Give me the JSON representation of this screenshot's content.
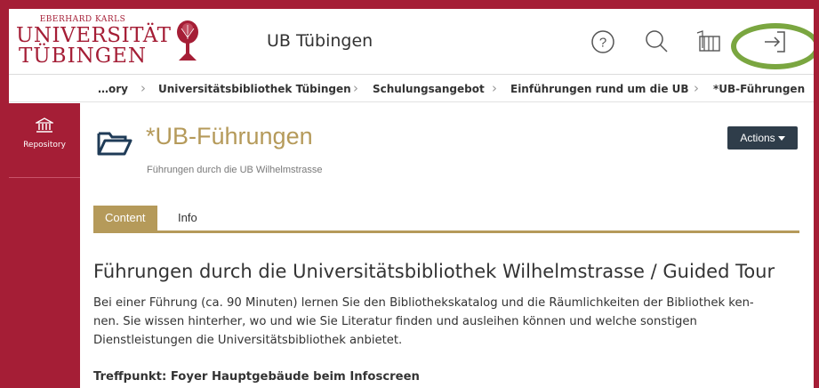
{
  "header": {
    "logo": {
      "line1": "EBERHARD KARLS",
      "line2": "UNIVERSITÄT",
      "line3": "TÜBINGEN"
    },
    "title": "UB Tübingen",
    "icons": [
      "help-icon",
      "search-icon",
      "library-icon",
      "login-icon"
    ]
  },
  "breadcrumb": {
    "items": [
      "…ory",
      "Universitätsbibliothek Tübingen",
      "Schulungsangebot",
      "Einführungen rund um die UB",
      "*UB-Führungen"
    ]
  },
  "sidebar": {
    "items": [
      {
        "label": "Repository",
        "icon": "institution-icon"
      }
    ]
  },
  "page": {
    "title": "*UB-Führungen",
    "subtitle": "Führungen durch die UB Wilhelmstrasse",
    "actions_label": "Actions",
    "tabs": [
      "Content",
      "Info"
    ],
    "active_tab": "Content"
  },
  "content": {
    "heading": "Führungen durch die Universitätsbibliothek Wilhelmstrasse / Guided Tour",
    "paragraph_lines": [
      "Bei einer Führung (ca. 90 Minuten)  lernen Sie den Bibliothekskatalog und die Räumlichkeiten der Bibliothek ken-",
      "nen. Sie wissen hinterher, wo und wie Sie Literatur finden und ausleihen können und welche sonstigen",
      "Dienstleistungen die Universitätsbibliothek anbietet."
    ],
    "meeting_point": "Treffpunkt: Foyer Hauptgebäude beim Infoscreen"
  },
  "colors": {
    "brand": "#a51e36",
    "accent": "#b59a5a",
    "button": "#2f3d4a",
    "highlight": "#7aa640"
  }
}
